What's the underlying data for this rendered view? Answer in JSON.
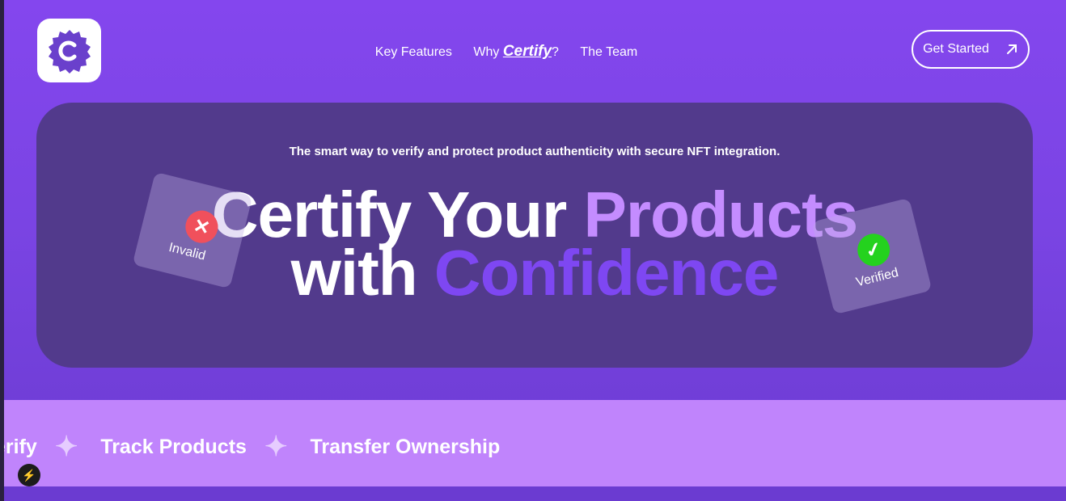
{
  "nav": {
    "logo_icon": "certify-logo-icon",
    "links": [
      {
        "label": "Key Features"
      },
      {
        "prefix": "Why ",
        "brand": "Certify",
        "suffix": "?"
      },
      {
        "label": "The Team"
      }
    ],
    "cta_label": "Get Started",
    "cta_icon": "arrow-up-right-icon"
  },
  "hero": {
    "tagline": "The smart way to verify and protect product authenticity with secure NFT integration.",
    "headline_line1_a": "Certify Your ",
    "headline_line1_b": "Products",
    "headline_line2_a": "with ",
    "headline_line2_b": "Confidence",
    "cards": {
      "invalid_label": "Invalid",
      "verified_label": "Verified"
    }
  },
  "marquee": {
    "items": [
      "erify",
      "Track Products",
      "Transfer Ownership"
    ]
  },
  "colors": {
    "background": "#8446ee",
    "hero_panel": "#523a8c",
    "accent_light": "#c48cff",
    "accent_strong": "#7e47f2",
    "marquee_bg": "#c084fc"
  }
}
